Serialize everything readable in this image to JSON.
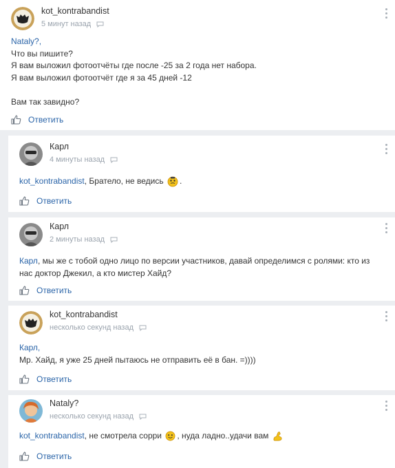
{
  "comments": [
    {
      "author": "kot_kontrabandist",
      "time": "5 минут назад",
      "mention": "Nataly?,",
      "lines": [
        "Что вы пишите?",
        "Я вам выложил фотоотчёты где после -25 за 2 года нет набора.",
        "Я вам выложил фотоотчёт где я за 45 дней -12",
        "",
        "Вам так завидно?"
      ],
      "reply_label": "Ответить"
    },
    {
      "author": "Карл",
      "time": "4 минуты назад",
      "mention": "kot_kontrabandist",
      "text": ", Брателo, не ведись",
      "after": ".",
      "reply_label": "Ответить"
    },
    {
      "author": "Карл",
      "time": "2 минуты назад",
      "mention": "Карл",
      "text": ", мы же с тобой одно лицо по версии участников, давай определимся с ролями: кто из нас доктор Джекил, а кто мистер Хайд?",
      "reply_label": "Ответить"
    },
    {
      "author": "kot_kontrabandist",
      "time": "несколько секунд назад",
      "mention": "Карл,",
      "lines": [
        "Мр. Хайд, я уже 25 дней пытаюсь не отправить её в бан. =))))"
      ],
      "reply_label": "Ответить"
    },
    {
      "author": "Nataly?",
      "time": "несколько секунд назад",
      "mention": "kot_kontrabandist",
      "text": ", не смотрела сорри",
      "after": ", нуда ладно..удачи вам",
      "reply_label": "Ответить"
    }
  ],
  "icons": [
    "more-vertical-icon",
    "comment-bubble-icon",
    "thumbs-up-icon",
    "emoji-icon",
    "flexed-biceps-icon"
  ],
  "colors": {
    "link": "#2a64a8",
    "meta": "#9aa3ad",
    "background": "#eceef1"
  }
}
